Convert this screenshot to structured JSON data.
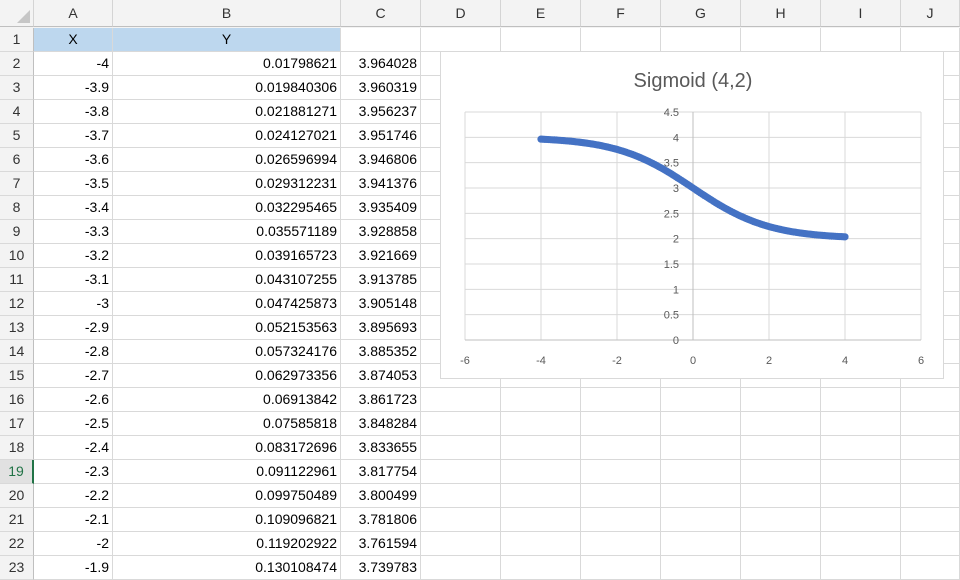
{
  "columns": [
    "A",
    "B",
    "C",
    "D",
    "E",
    "F",
    "G",
    "H",
    "I",
    "J"
  ],
  "selected_row": 19,
  "header_row": {
    "row": 1,
    "a": "X",
    "b": "Y",
    "c": ""
  },
  "rows": [
    {
      "row": 2,
      "a": "-4",
      "b": "0.01798621",
      "c": "3.964028"
    },
    {
      "row": 3,
      "a": "-3.9",
      "b": "0.019840306",
      "c": "3.960319"
    },
    {
      "row": 4,
      "a": "-3.8",
      "b": "0.021881271",
      "c": "3.956237"
    },
    {
      "row": 5,
      "a": "-3.7",
      "b": "0.024127021",
      "c": "3.951746"
    },
    {
      "row": 6,
      "a": "-3.6",
      "b": "0.026596994",
      "c": "3.946806"
    },
    {
      "row": 7,
      "a": "-3.5",
      "b": "0.029312231",
      "c": "3.941376"
    },
    {
      "row": 8,
      "a": "-3.4",
      "b": "0.032295465",
      "c": "3.935409"
    },
    {
      "row": 9,
      "a": "-3.3",
      "b": "0.035571189",
      "c": "3.928858"
    },
    {
      "row": 10,
      "a": "-3.2",
      "b": "0.039165723",
      "c": "3.921669"
    },
    {
      "row": 11,
      "a": "-3.1",
      "b": "0.043107255",
      "c": "3.913785"
    },
    {
      "row": 12,
      "a": "-3",
      "b": "0.047425873",
      "c": "3.905148"
    },
    {
      "row": 13,
      "a": "-2.9",
      "b": "0.052153563",
      "c": "3.895693"
    },
    {
      "row": 14,
      "a": "-2.8",
      "b": "0.057324176",
      "c": "3.885352"
    },
    {
      "row": 15,
      "a": "-2.7",
      "b": "0.062973356",
      "c": "3.874053"
    },
    {
      "row": 16,
      "a": "-2.6",
      "b": "0.06913842",
      "c": "3.861723"
    },
    {
      "row": 17,
      "a": "-2.5",
      "b": "0.07585818",
      "c": "3.848284"
    },
    {
      "row": 18,
      "a": "-2.4",
      "b": "0.083172696",
      "c": "3.833655"
    },
    {
      "row": 19,
      "a": "-2.3",
      "b": "0.091122961",
      "c": "3.817754"
    },
    {
      "row": 20,
      "a": "-2.2",
      "b": "0.099750489",
      "c": "3.800499"
    },
    {
      "row": 21,
      "a": "-2.1",
      "b": "0.109096821",
      "c": "3.781806"
    },
    {
      "row": 22,
      "a": "-2",
      "b": "0.119202922",
      "c": "3.761594"
    },
    {
      "row": 23,
      "a": "-1.9",
      "b": "0.130108474",
      "c": "3.739783"
    }
  ],
  "chart_data": {
    "type": "scatter",
    "title": "Sigmoid (4,2)",
    "xlim": [
      -6,
      6
    ],
    "ylim": [
      0,
      4.5
    ],
    "x_ticks": [
      "-6",
      "-4",
      "-2",
      "0",
      "2",
      "4",
      "6"
    ],
    "y_ticks": [
      "0",
      "0.5",
      "1",
      "1.5",
      "2",
      "2.5",
      "3",
      "3.5",
      "4",
      "4.5"
    ],
    "gridlines": true,
    "legend": "none",
    "color": "#4472c4",
    "x": [
      -4,
      -3.8,
      -3.6,
      -3.4,
      -3.2,
      -3,
      -2.8,
      -2.6,
      -2.4,
      -2.2,
      -2,
      -1.8,
      -1.6,
      -1.4,
      -1.2,
      -1,
      -0.8,
      -0.6,
      -0.4,
      -0.2,
      0,
      0.2,
      0.4,
      0.6,
      0.8,
      1,
      1.2,
      1.4,
      1.6,
      1.8,
      2,
      2.2,
      2.4,
      2.6,
      2.8,
      3,
      3.2,
      3.4,
      3.6,
      3.8,
      4
    ],
    "y": [
      3.964,
      3.956,
      3.947,
      3.935,
      3.922,
      3.905,
      3.885,
      3.862,
      3.834,
      3.8,
      3.762,
      3.716,
      3.664,
      3.604,
      3.537,
      3.462,
      3.38,
      3.292,
      3.197,
      3.1,
      3.0,
      2.9,
      2.803,
      2.708,
      2.62,
      2.538,
      2.463,
      2.396,
      2.336,
      2.284,
      2.238,
      2.2,
      2.166,
      2.138,
      2.115,
      2.095,
      2.078,
      2.065,
      2.053,
      2.044,
      2.036
    ]
  }
}
